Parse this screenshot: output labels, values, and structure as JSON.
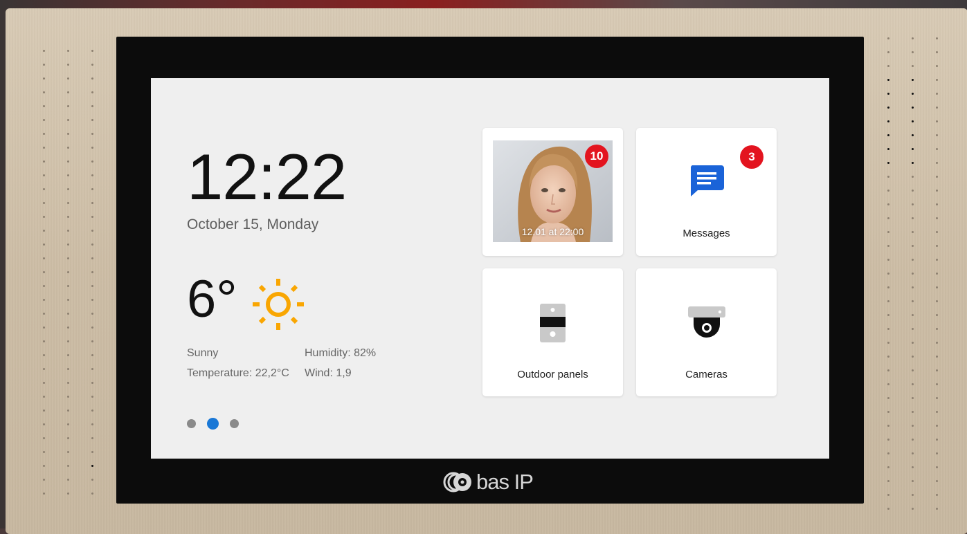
{
  "device": {
    "brand_logo": "bas IP",
    "speaker_grille": "decorative"
  },
  "home_screen": {
    "clock": "12:22",
    "date": "October 15, Monday",
    "weather": {
      "temperature": "6°",
      "icon": "sun-icon",
      "condition": "Sunny",
      "humidity": "Humidity: 82%",
      "temperature_detail": "Temperature: 22,2°C",
      "wind": "Wind: 1,9",
      "icon_color": "#f9a602"
    },
    "pagination": {
      "pages": 3,
      "active_index": 1,
      "active_color": "#1a78d6"
    }
  },
  "tiles": {
    "visitor_photo": {
      "badge": "10",
      "timestamp": "12.01 at 22:00"
    },
    "messages": {
      "label": "Messages",
      "badge": "3",
      "icon": "message-icon",
      "icon_color": "#1a63d8"
    },
    "outdoor_panels": {
      "label": "Outdoor panels",
      "icon": "outdoor-panel-icon"
    },
    "cameras": {
      "label": "Cameras",
      "icon": "camera-icon"
    }
  },
  "colors": {
    "badge": "#e3141f",
    "accent": "#1a78d6",
    "sun": "#f9a602"
  }
}
